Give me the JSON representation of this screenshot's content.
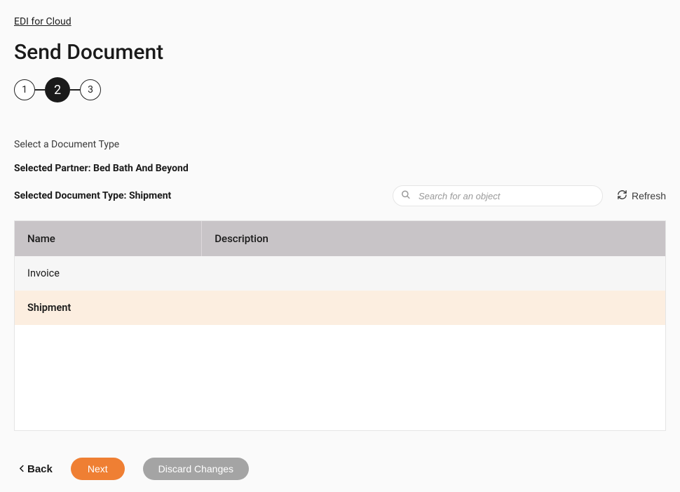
{
  "breadcrumb": {
    "label": "EDI for Cloud"
  },
  "page": {
    "title": "Send Document"
  },
  "stepper": {
    "steps": [
      "1",
      "2",
      "3"
    ],
    "activeIndex": 1
  },
  "section": {
    "label": "Select a Document Type"
  },
  "selected": {
    "partnerLabel": "Selected Partner: Bed Bath And Beyond",
    "docTypeLabel": "Selected Document Type: Shipment"
  },
  "search": {
    "placeholder": "Search for an object"
  },
  "refresh": {
    "label": "Refresh"
  },
  "table": {
    "headers": {
      "name": "Name",
      "description": "Description"
    },
    "rows": [
      {
        "name": "Invoice",
        "description": "",
        "selected": false
      },
      {
        "name": "Shipment",
        "description": "",
        "selected": true
      }
    ]
  },
  "footer": {
    "back": "Back",
    "next": "Next",
    "discard": "Discard Changes"
  }
}
